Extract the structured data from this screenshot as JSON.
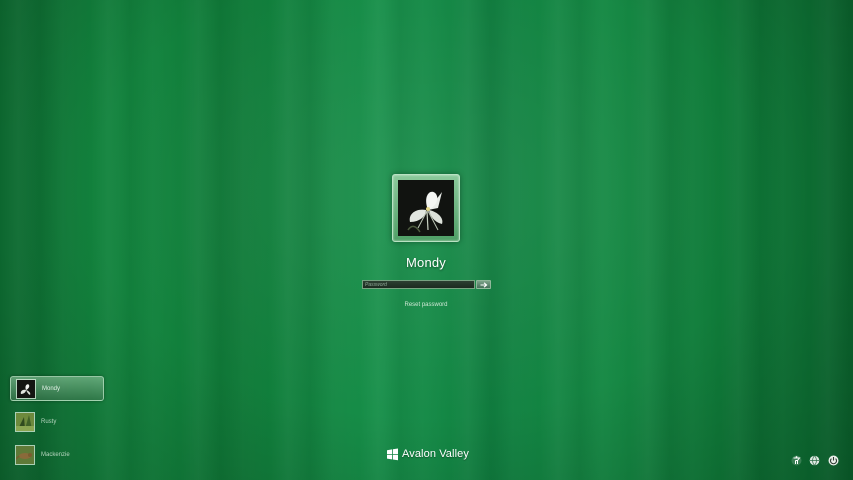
{
  "login": {
    "username": "Mondy",
    "password_placeholder": "Password",
    "reset_link": "Reset password",
    "submit_icon": "arrow-right-icon"
  },
  "users": [
    {
      "name": "Mondy",
      "selected": true,
      "avatar": "white-flower"
    },
    {
      "name": "Rusty",
      "selected": false,
      "avatar": "green-plant"
    },
    {
      "name": "Mackenzie",
      "selected": false,
      "avatar": "lizard"
    }
  ],
  "branding": {
    "logo": "windows-flag-icon",
    "name": "Avalon Valley"
  },
  "system_icons": [
    "ease-of-access-icon",
    "network-icon",
    "power-icon"
  ],
  "colors": {
    "background": "#118540",
    "background_dark": "#0b6a30",
    "tile_frame": "#6db582",
    "text": "#ffffff"
  }
}
